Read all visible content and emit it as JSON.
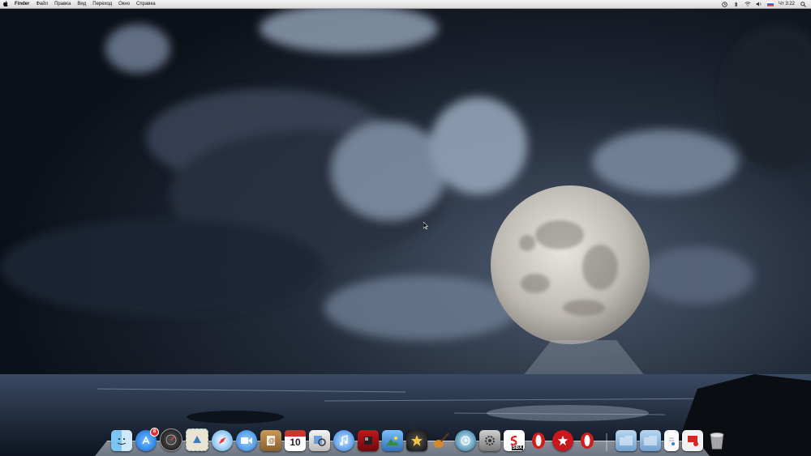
{
  "menubar": {
    "apple_icon": "apple-logo-icon",
    "app_name": "Finder",
    "menus": [
      "Файл",
      "Правка",
      "Вид",
      "Переход",
      "Окно",
      "Справка"
    ],
    "status_icons": [
      "time-machine-icon",
      "bluetooth-icon",
      "wifi-icon",
      "volume-icon",
      "flag-ru-icon"
    ],
    "clock": "Чт 3:22",
    "search_icon": "spotlight-icon"
  },
  "wallpaper": {
    "description_icon": "moon-over-ocean-wallpaper",
    "colors": {
      "sky_dark": "#1a2230",
      "cloud": "#8a98ab",
      "moon": "#d9d6d0",
      "sea": "#2b3950"
    }
  },
  "dock": {
    "apps": [
      {
        "name": "finder",
        "icon": "finder-icon"
      },
      {
        "name": "app-store",
        "icon": "app-store-icon",
        "badge": "8"
      },
      {
        "name": "dashboard",
        "icon": "dashboard-icon"
      },
      {
        "name": "mail",
        "icon": "mail-stamp-icon"
      },
      {
        "name": "safari",
        "icon": "safari-compass-icon"
      },
      {
        "name": "facetime",
        "icon": "facetime-icon"
      },
      {
        "name": "address-book",
        "icon": "address-book-icon"
      },
      {
        "name": "ical",
        "icon": "calendar-icon",
        "day": "10"
      },
      {
        "name": "preview",
        "icon": "preview-icon"
      },
      {
        "name": "itunes",
        "icon": "itunes-icon"
      },
      {
        "name": "photo-booth",
        "icon": "photo-booth-icon"
      },
      {
        "name": "iphoto",
        "icon": "iphoto-icon"
      },
      {
        "name": "imovie",
        "icon": "imovie-star-icon"
      },
      {
        "name": "garageband",
        "icon": "garageband-guitar-icon"
      },
      {
        "name": "time-machine",
        "icon": "time-machine-icon"
      },
      {
        "name": "system-preferences",
        "icon": "system-preferences-icon"
      },
      {
        "name": "sandboxie",
        "icon": "sandbox-icon",
        "label": "SBX"
      },
      {
        "name": "opera-1",
        "icon": "opera-icon"
      },
      {
        "name": "pokerstars",
        "icon": "pokerstars-icon"
      },
      {
        "name": "opera-2",
        "icon": "opera-icon"
      }
    ],
    "stacks": [
      {
        "name": "applications-folder",
        "icon": "folder-icon"
      },
      {
        "name": "documents-folder",
        "icon": "folder-icon"
      },
      {
        "name": "document-1",
        "icon": "document-icon"
      },
      {
        "name": "downloads",
        "icon": "downloads-icon"
      },
      {
        "name": "trash",
        "icon": "trash-icon"
      }
    ]
  }
}
